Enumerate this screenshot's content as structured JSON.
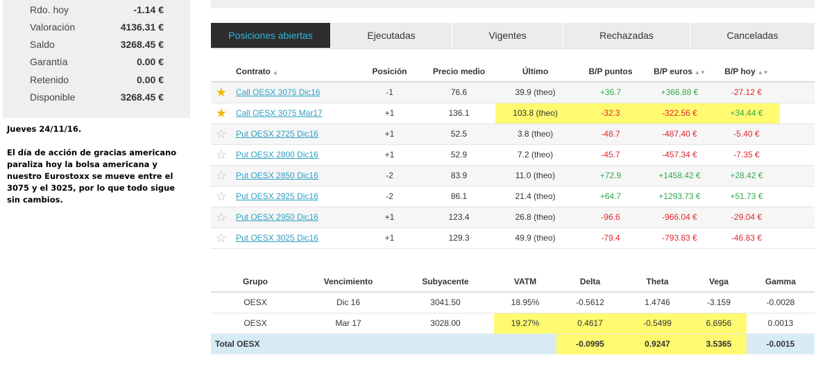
{
  "account": [
    {
      "label": "Rdo. hoy",
      "value": "-1.14 €"
    },
    {
      "label": "Valoración",
      "value": "4136.31 €"
    },
    {
      "label": "Saldo",
      "value": "3268.45 €"
    },
    {
      "label": "Garantía",
      "value": "0.00 €"
    },
    {
      "label": "Retenido",
      "value": "0.00 €"
    },
    {
      "label": "Disponible",
      "value": "3268.45 €"
    }
  ],
  "notes": {
    "date": "Jueves 24/11/16.",
    "body": "El día de acción de gracias americano paraliza hoy la bolsa americana y nuestro Eurostoxx se mueve entre el 3075 y el 3025, por lo que todo sigue sin cambios."
  },
  "tabs": [
    "Posiciones abiertas",
    "Ejecutadas",
    "Vigentes",
    "Rechazadas",
    "Canceladas"
  ],
  "positions": {
    "headers": {
      "contract": "Contrato",
      "position": "Posición",
      "avg_price": "Precio medio",
      "last": "Último",
      "pl_points": "B/P puntos",
      "pl_euros": "B/P euros",
      "pl_today": "B/P hoy"
    },
    "rows": [
      {
        "fav": true,
        "contract": "Call OESX 3075 Dic16",
        "position": "-1",
        "avg_price": "76.6",
        "last": "39.9 (theo)",
        "pl_points": "+36.7",
        "pl_euros": "+366.88 €",
        "pl_today": "-27.12 €"
      },
      {
        "fav": true,
        "contract": "Call OESX 3075 Mar17",
        "position": "+1",
        "avg_price": "136.1",
        "last": "103.8 (theo)",
        "pl_points": "-32.3",
        "pl_euros": "-322.56 €",
        "pl_today": "+34.44 €"
      },
      {
        "fav": false,
        "contract": "Put OESX 2725 Dic16",
        "position": "+1",
        "avg_price": "52.5",
        "last": "3.8 (theo)",
        "pl_points": "-48.7",
        "pl_euros": "-487.40 €",
        "pl_today": "-5.40 €"
      },
      {
        "fav": false,
        "contract": "Put OESX 2800 Dic16",
        "position": "+1",
        "avg_price": "52.9",
        "last": "7.2 (theo)",
        "pl_points": "-45.7",
        "pl_euros": "-457.34 €",
        "pl_today": "-7.35 €"
      },
      {
        "fav": false,
        "contract": "Put OESX 2850 Dic16",
        "position": "-2",
        "avg_price": "83.9",
        "last": "11.0 (theo)",
        "pl_points": "+72.9",
        "pl_euros": "+1458.42 €",
        "pl_today": "+28.42 €"
      },
      {
        "fav": false,
        "contract": "Put OESX 2925 Dic16",
        "position": "-2",
        "avg_price": "86.1",
        "last": "21.4 (theo)",
        "pl_points": "+64.7",
        "pl_euros": "+1293.73 €",
        "pl_today": "+51.73 €"
      },
      {
        "fav": false,
        "contract": "Put OESX 2950 Dic16",
        "position": "+1",
        "avg_price": "123.4",
        "last": "26.8 (theo)",
        "pl_points": "-96.6",
        "pl_euros": "-966.04 €",
        "pl_today": "-29.04 €"
      },
      {
        "fav": false,
        "contract": "Put OESX 3025 Dic16",
        "position": "+1",
        "avg_price": "129.3",
        "last": "49.9 (theo)",
        "pl_points": "-79.4",
        "pl_euros": "-793.83 €",
        "pl_today": "-46.83 €"
      }
    ]
  },
  "greeks": {
    "headers": [
      "Grupo",
      "Vencimiento",
      "Subyacente",
      "VATM",
      "Delta",
      "Theta",
      "Vega",
      "Gamma"
    ],
    "rows": [
      [
        "OESX",
        "Dic 16",
        "3041.50",
        "18.95%",
        "-0.5612",
        "1.4746",
        "-3.159",
        "-0.0028"
      ],
      [
        "OESX",
        "Mar 17",
        "3028.00",
        "19.27%",
        "0.4617",
        "-0.5499",
        "6.6956",
        "0.0013"
      ]
    ],
    "total": {
      "label": "Total OESX",
      "delta": "-0.0995",
      "theta": "0.9247",
      "vega": "3.5365",
      "gamma": "-0.0015"
    }
  },
  "colors": {
    "tab_active_bg": "#2d2d2d",
    "tab_active_text": "#2fb6de",
    "gain": "#2fa84a",
    "loss": "#e0262c",
    "link": "#2a9fc4",
    "highlight": "#fffa70",
    "total_bg": "#d7ebf5",
    "star_on": "#f2b705"
  }
}
